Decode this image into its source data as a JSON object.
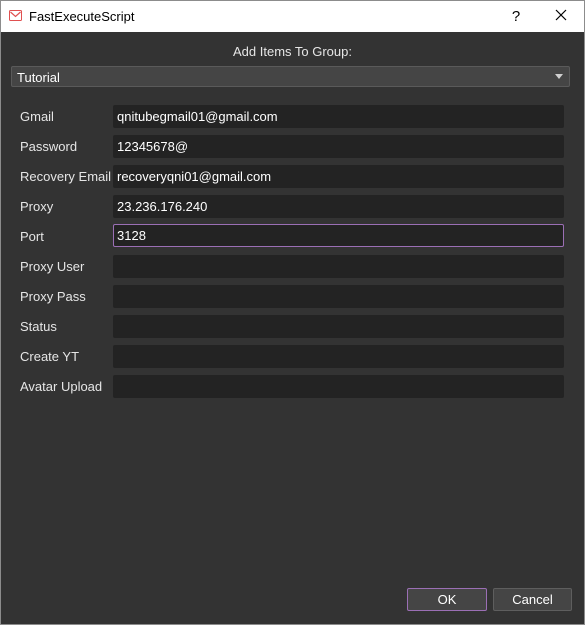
{
  "window": {
    "title": "FastExecuteScript",
    "help_label": "?",
    "icon": "app-logo-icon"
  },
  "dialog": {
    "heading": "Add Items To Group:",
    "group_select": {
      "value": "Tutorial"
    },
    "fields": [
      {
        "label": "Gmail",
        "value": "qnitubegmail01@gmail.com"
      },
      {
        "label": "Password",
        "value": "12345678@"
      },
      {
        "label": "Recovery Email",
        "value": "recoveryqni01@gmail.com"
      },
      {
        "label": "Proxy",
        "value": "23.236.176.240"
      },
      {
        "label": "Port",
        "value": "3128"
      },
      {
        "label": "Proxy User",
        "value": ""
      },
      {
        "label": "Proxy Pass",
        "value": ""
      },
      {
        "label": "Status",
        "value": ""
      },
      {
        "label": "Create YT",
        "value": ""
      },
      {
        "label": "Avatar Upload",
        "value": ""
      }
    ],
    "ok_label": "OK",
    "cancel_label": "Cancel"
  },
  "colors": {
    "background": "#333333",
    "field_bg": "#232323",
    "focus_accent": "#9b6fb5",
    "titlebar": "#ffffff"
  }
}
